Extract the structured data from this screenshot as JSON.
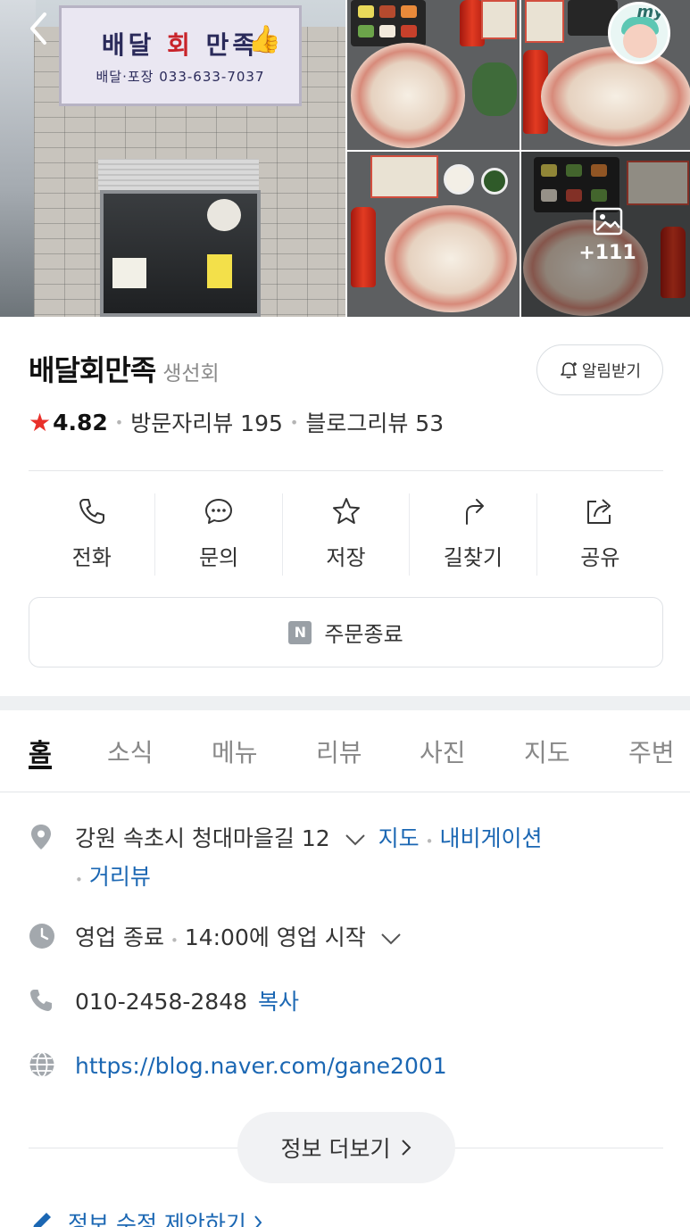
{
  "gallery": {
    "sign_title_a": "배달",
    "sign_title_red": "회",
    "sign_title_b": "만족",
    "sign_sub": "배달·포장 033-633-7037",
    "more_count": "+111",
    "my_badge": "my"
  },
  "place": {
    "name": "배달회만족",
    "category": "생선회",
    "alarm_label": "알림받기",
    "rating": "4.82",
    "visit_reviews": "방문자리뷰 195",
    "blog_reviews": "블로그리뷰 53"
  },
  "actions": [
    {
      "label": "전화",
      "icon": "phone-icon"
    },
    {
      "label": "문의",
      "icon": "chat-icon"
    },
    {
      "label": "저장",
      "icon": "star-icon"
    },
    {
      "label": "길찾기",
      "icon": "directions-icon"
    },
    {
      "label": "공유",
      "icon": "share-icon"
    }
  ],
  "order": {
    "badge": "N",
    "label": "주문종료"
  },
  "tabs": [
    "홈",
    "소식",
    "메뉴",
    "리뷰",
    "사진",
    "지도",
    "주변"
  ],
  "info": {
    "address": "강원 속초시 청대마을길 12",
    "map_link": "지도",
    "navi_link": "내비게이션",
    "street_link": "거리뷰",
    "status": "영업 종료",
    "hours": "14:00에 영업 시작",
    "phone": "010-2458-2848",
    "copy_link": "복사",
    "website": "https://blog.naver.com/gane2001"
  },
  "more_info_label": "정보 더보기",
  "suggest_label": "정보 수정 제안하기",
  "colors": {
    "accent_blue": "#1b67b3",
    "star_red": "#e9302a"
  }
}
